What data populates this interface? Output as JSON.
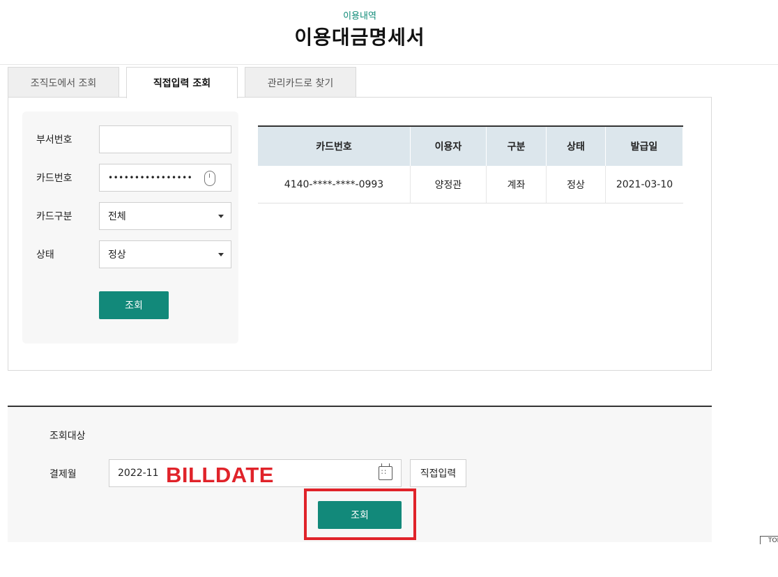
{
  "header": {
    "subtitle": "이용내역",
    "title": "이용대금명세서"
  },
  "tabs": [
    {
      "label": "조직도에서 조회",
      "active": false
    },
    {
      "label": "직접입력 조회",
      "active": true
    },
    {
      "label": "관리카드로 찾기",
      "active": false
    }
  ],
  "search_form": {
    "dept_label": "부서번호",
    "dept_value": "",
    "card_label": "카드번호",
    "card_value": "••••••••••••••••",
    "card_type_label": "카드구분",
    "card_type_value": "전체",
    "status_label": "상태",
    "status_value": "정상",
    "search_button": "조회"
  },
  "result_table": {
    "headers": [
      "카드번호",
      "이용자",
      "구분",
      "상태",
      "발급일"
    ],
    "rows": [
      [
        "4140-****-****-0993",
        "양정관",
        "계좌",
        "정상",
        "2021-03-10"
      ]
    ]
  },
  "query": {
    "target_label": "조회대상",
    "month_label": "결제월",
    "month_value": "2022-11",
    "annotation": "BILLDATE",
    "direct_input_button": "직접입력",
    "search_button": "조회"
  },
  "colors": {
    "accent": "#12897a",
    "highlight": "#e0232a",
    "table_header": "#dce6ec"
  },
  "icons": {
    "secure_input": "mouse-icon",
    "select_arrow": "caret-down-icon",
    "date_picker": "calendar-icon"
  },
  "top_button": "TOP"
}
